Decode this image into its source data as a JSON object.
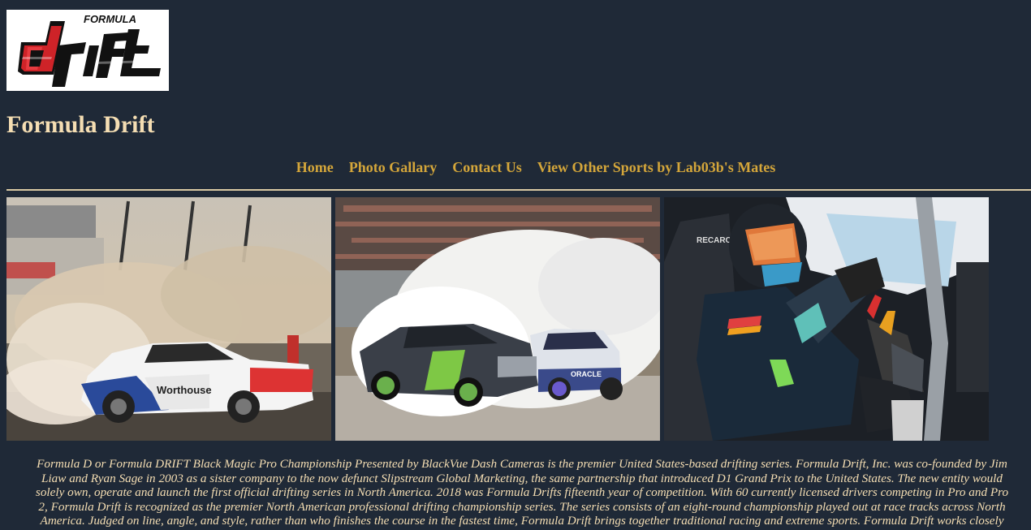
{
  "logo": {
    "alt_text": "FORMULA DRIFT",
    "colors": {
      "red": "#e3262b",
      "black": "#111111",
      "white": "#ffffff"
    }
  },
  "page": {
    "title": "Formula Drift",
    "colors": {
      "background": "#1f2937",
      "text": "#f5deb3",
      "link": "#d4a63a",
      "rule": "#d9c9a3"
    }
  },
  "nav": {
    "items": [
      {
        "label": "Home"
      },
      {
        "label": "Photo Gallary"
      },
      {
        "label": "Contact Us"
      },
      {
        "label": "View Other Sports by Lab03b's Mates"
      }
    ]
  },
  "photos": [
    {
      "caption": "Worthouse"
    },
    {
      "caption": "ORACLE"
    },
    {
      "caption": "RECARO"
    }
  ],
  "description": {
    "lines": [
      "Formula D or Formula DRIFT Black Magic Pro Championship Presented by BlackVue Dash Cameras is the premier United States-based drifting series. Formula Drift, Inc. was co-founded by Jim",
      "Liaw and Ryan Sage in 2003 as a sister company to the now defunct Slipstream Global Marketing, the same partnership that introduced D1 Grand Prix to the United States. The new entity would",
      "solely own, operate and launch the first official drifting series in North America. 2018 was Formula Drifts fifteenth year of competition. With 60 currently licensed drivers competing in Pro and Pro",
      "2, Formula Drift is recognized as the premier North American professional drifting championship series. The series consists of an eight-round championship played out at race tracks across North",
      "America. Judged on line, angle, and style, rather than who finishes the course in the fastest time, Formula Drift brings together traditional racing and extreme sports. Formula Drift works closely"
    ]
  }
}
